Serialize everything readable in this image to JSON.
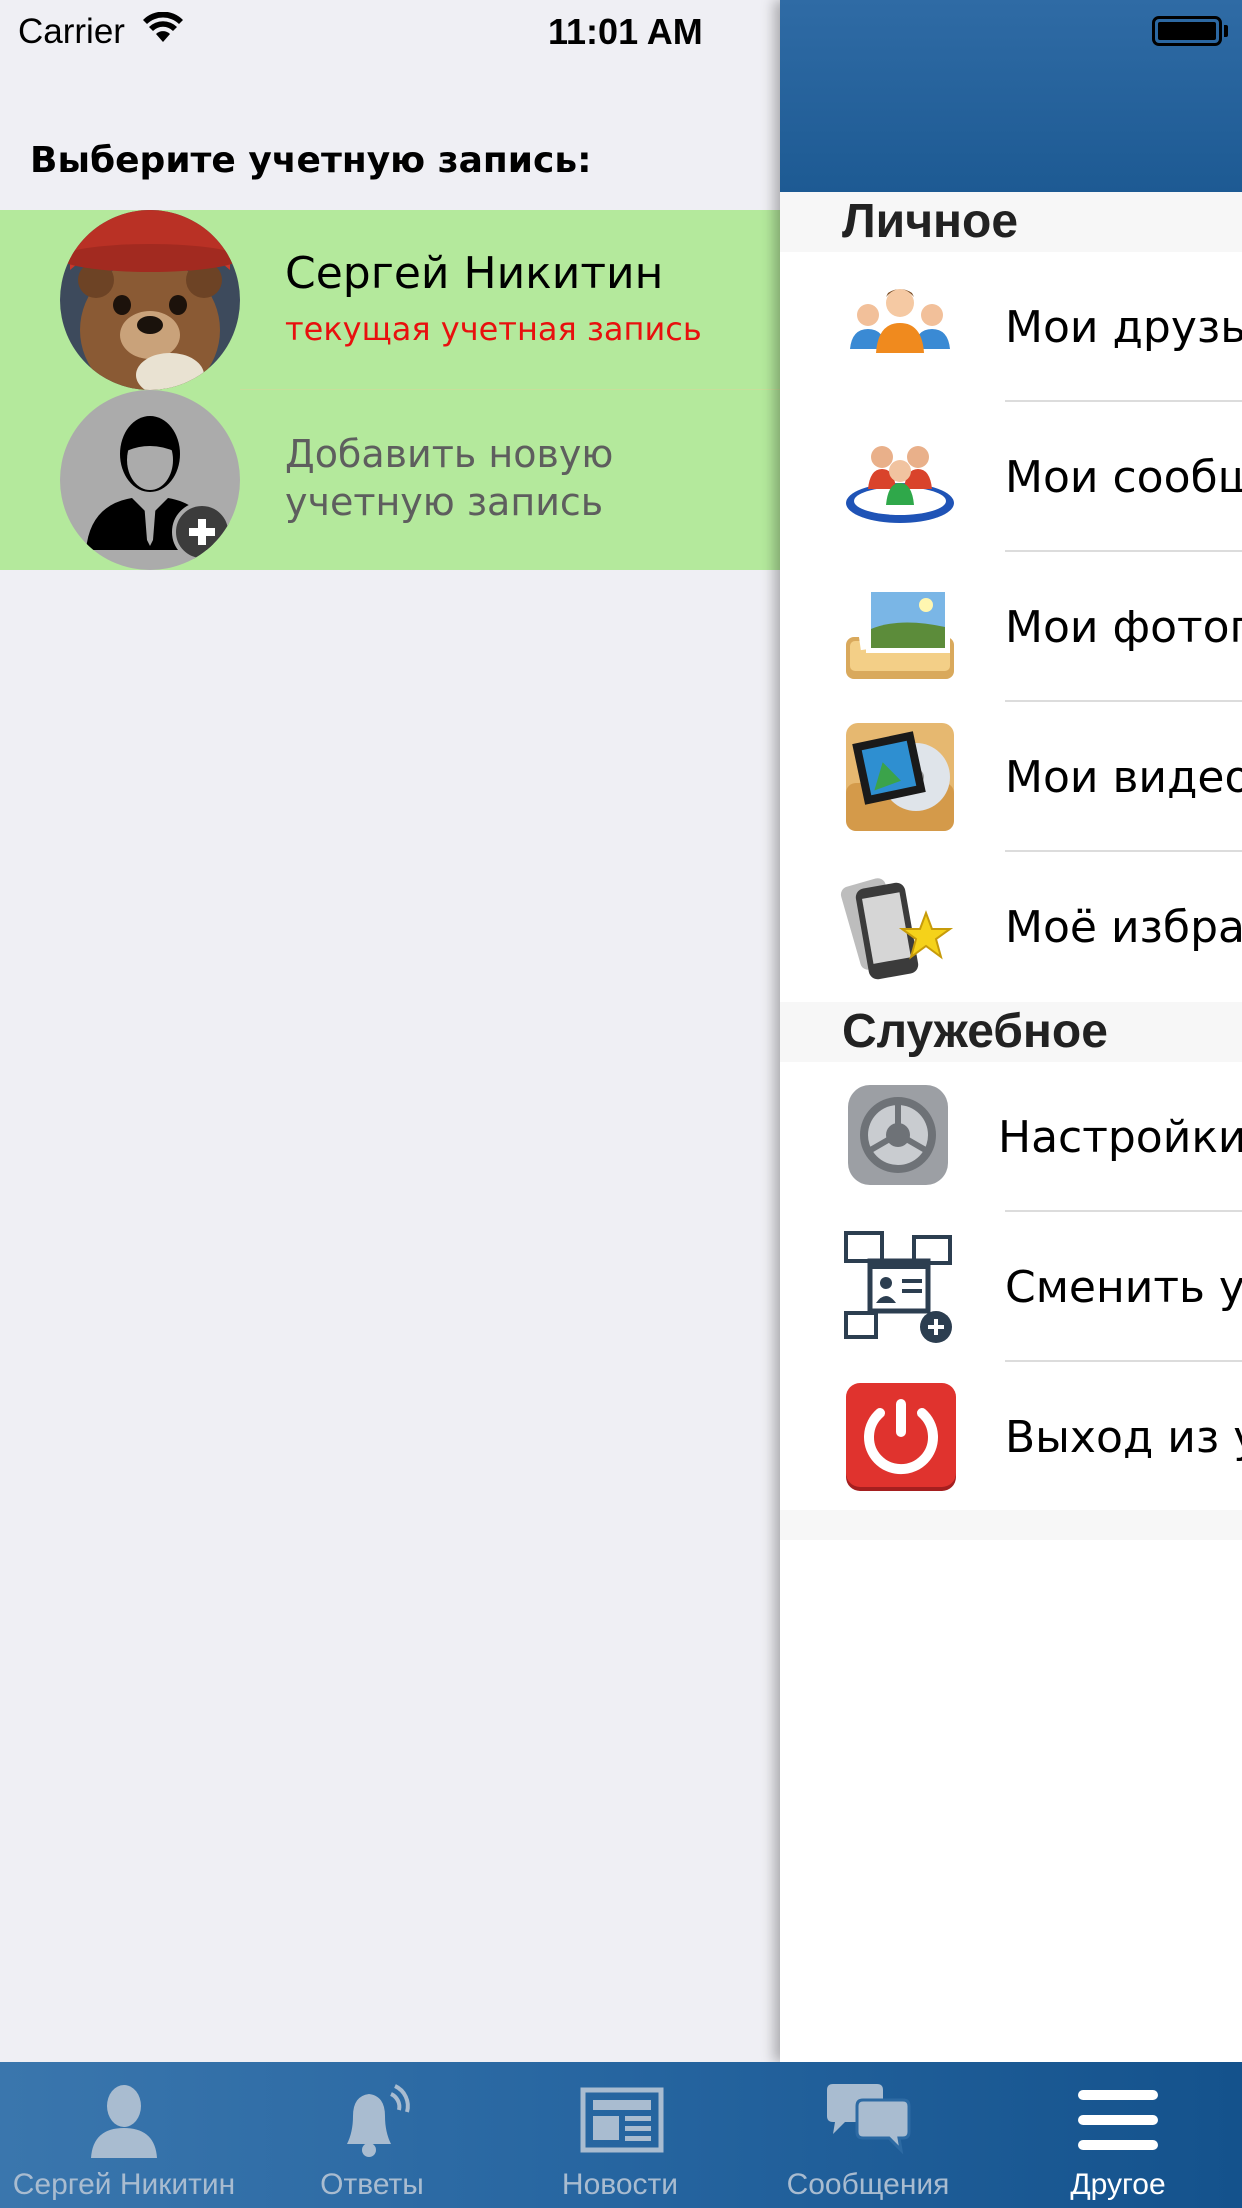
{
  "status_bar": {
    "carrier": "Carrier",
    "time": "11:01 AM"
  },
  "accounts": {
    "title": "Выберите учетную запись:",
    "current": {
      "name": "Сергей Никитин",
      "subtitle": "текущая учетная запись"
    },
    "add_new": {
      "label": "Добавить новую учетную запись"
    }
  },
  "drawer": {
    "sections": [
      {
        "title": "Личное",
        "items": [
          {
            "label": "Мои друзья",
            "icon": "friends-icon"
          },
          {
            "label": "Мои сообщества",
            "icon": "communities-icon"
          },
          {
            "label": "Мои фотографии",
            "icon": "photos-icon"
          },
          {
            "label": "Мои видео",
            "icon": "videos-icon"
          },
          {
            "label": "Моё избранное",
            "icon": "favorites-icon"
          }
        ]
      },
      {
        "title": "Служебное",
        "items": [
          {
            "label": "Настройки",
            "icon": "settings-icon"
          },
          {
            "label": "Сменить учетную запись",
            "icon": "switch-account-icon"
          },
          {
            "label": "Выход из учетной записи",
            "icon": "logout-icon"
          }
        ]
      }
    ]
  },
  "tabbar": {
    "tabs": [
      {
        "label": "Сергей Никитин",
        "icon": "person-icon",
        "active": false
      },
      {
        "label": "Ответы",
        "icon": "bell-icon",
        "active": false
      },
      {
        "label": "Новости",
        "icon": "newspaper-icon",
        "active": false
      },
      {
        "label": "Сообщения",
        "icon": "chat-bubbles-icon",
        "active": false
      },
      {
        "label": "Другое",
        "icon": "menu-icon",
        "active": true
      }
    ]
  },
  "colors": {
    "account_highlight": "#b4e99c",
    "header_blue": "#2565a0",
    "subtitle_red": "#e8100e"
  }
}
